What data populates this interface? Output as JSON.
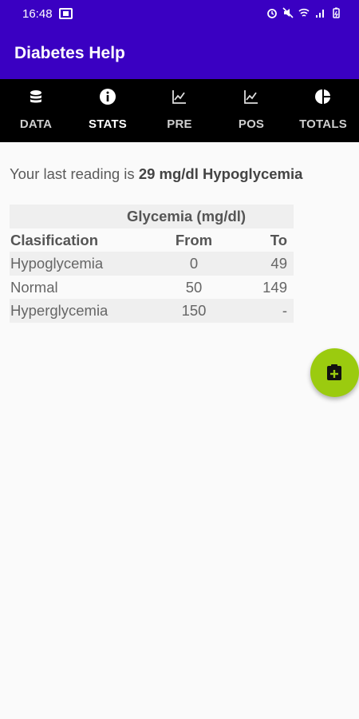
{
  "status": {
    "time": "16:48"
  },
  "app": {
    "title": "Diabetes Help"
  },
  "tabs": [
    {
      "label": "DATA",
      "icon": "database-icon"
    },
    {
      "label": "STATS",
      "icon": "info-icon"
    },
    {
      "label": "PRE",
      "icon": "line-chart-icon"
    },
    {
      "label": "POS",
      "icon": "line-chart-icon"
    },
    {
      "label": "TOTALS",
      "icon": "pie-chart-icon"
    }
  ],
  "active_tab": "STATS",
  "reading": {
    "prefix": "Your last reading is",
    "value": "29 mg/dl Hypoglycemia"
  },
  "glycemia_table": {
    "caption": "Glycemia (mg/dl)",
    "headers": [
      "Clasification",
      "From",
      "To"
    ],
    "rows": [
      {
        "name": "Hypoglycemia",
        "from": "0",
        "to": "49"
      },
      {
        "name": "Normal",
        "from": "50",
        "to": "149"
      },
      {
        "name": "Hyperglycemia",
        "from": "150",
        "to": "-"
      }
    ]
  },
  "fab": {
    "icon": "add-clipboard-icon"
  },
  "colors": {
    "primary": "#3a00c2",
    "tabbar": "#000000",
    "indicator": "#43c2c9",
    "fab": "#9bcb0f"
  }
}
